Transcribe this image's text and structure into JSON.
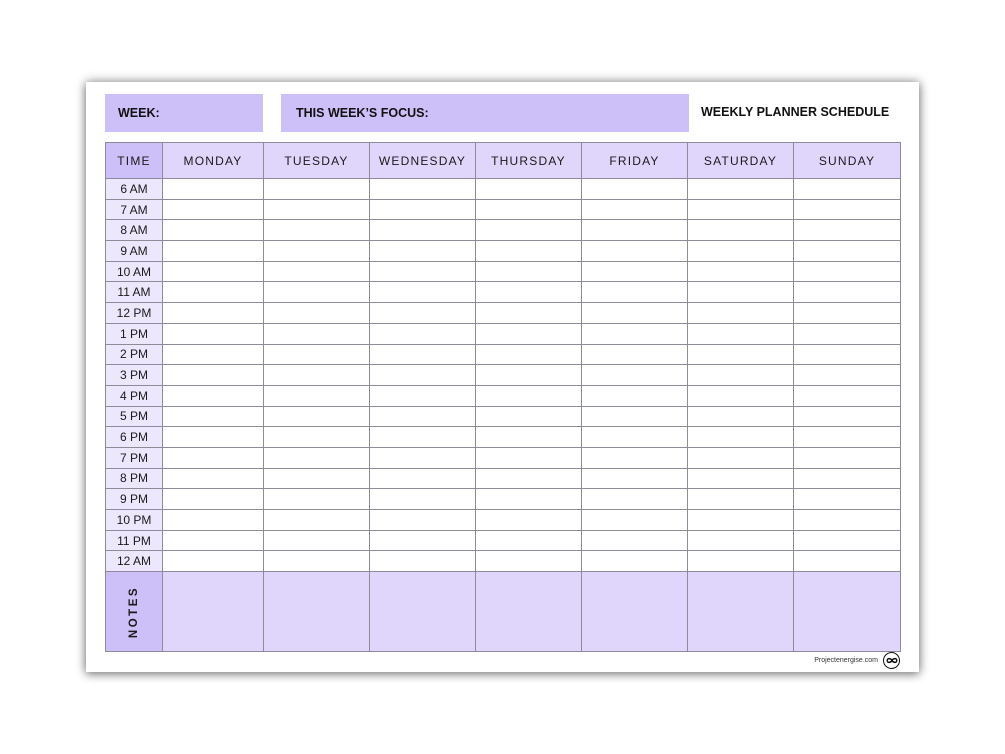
{
  "header": {
    "week_label": "WEEK:",
    "focus_label": "THIS WEEK’S FOCUS:",
    "title": "WEEKLY PLANNER SCHEDULE"
  },
  "table": {
    "time_header": "TIME",
    "days": [
      "MONDAY",
      "TUESDAY",
      "WEDNESDAY",
      "THURSDAY",
      "FRIDAY",
      "SATURDAY",
      "SUNDAY"
    ],
    "times": [
      "6 AM",
      "7 AM",
      "8 AM",
      "9 AM",
      "10 AM",
      "11 AM",
      "12 PM",
      "1 PM",
      "2 PM",
      "3 PM",
      "4 PM",
      "5 PM",
      "6 PM",
      "7 PM",
      "8 PM",
      "9 PM",
      "10 PM",
      "11 PM",
      "12 AM"
    ],
    "notes_label": "NOTES"
  },
  "footer": {
    "site": "Projectenergise.com",
    "logo_icon": "infinity-icon"
  },
  "colors": {
    "accent": "#cdbff7",
    "header_fill": "#e0d6fc",
    "time_fill": "#ede7fd",
    "grid_line": "#8f8a98"
  }
}
